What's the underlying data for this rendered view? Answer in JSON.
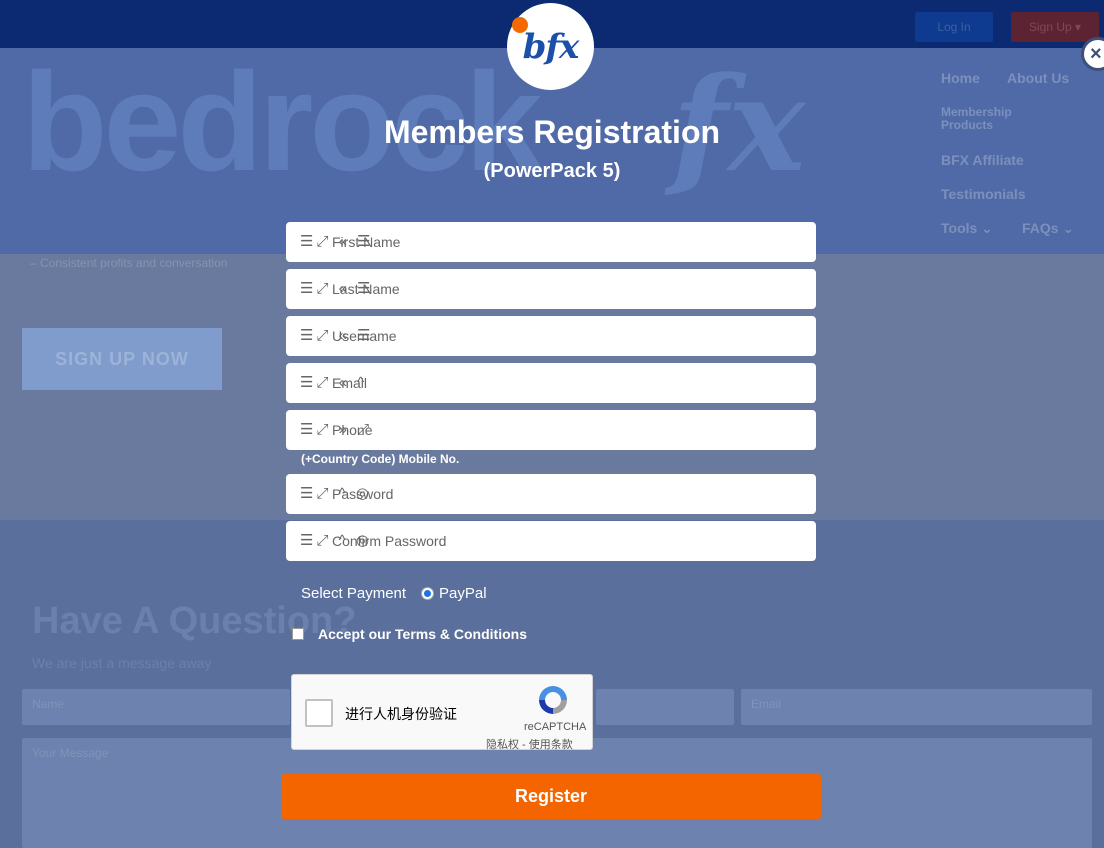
{
  "background": {
    "topbar": {
      "login_label": "Log In",
      "signup_label": "Sign Up ▾"
    },
    "logo_text": "bedrock",
    "logo_fx": "fx",
    "nav": [
      {
        "label": "Home"
      },
      {
        "label": "About Us"
      },
      {
        "label": "Membership Products"
      },
      {
        "label": "BFX Affiliate"
      },
      {
        "label": "Testimonials"
      },
      {
        "label": "Tools ⌄"
      },
      {
        "label": "FAQs ⌄"
      }
    ],
    "tagline": "– Consistent profits and conversation",
    "signup_now": "SIGN UP NOW",
    "question_title": "Have A Question?",
    "question_subtitle": "We are just a message away",
    "name_placeholder": "Name",
    "email_placeholder": "Email",
    "message_placeholder": "Your Message"
  },
  "modal": {
    "logo": "bfx",
    "close_icon": "×",
    "title": "Members Registration",
    "subtitle": "(PowerPack 5)",
    "fields": [
      {
        "placeholder": "First Name",
        "icons": "☰⤢ « ☰"
      },
      {
        "placeholder": "Last Name",
        "icons": "☰⤢ « ☰"
      },
      {
        "placeholder": "Username",
        "icons": "☰⤢ « ☰"
      },
      {
        "placeholder": "Email",
        "icons": "☰⤢ « ^"
      },
      {
        "placeholder": "Phone",
        "icons": "☰⤢ » ⤢"
      },
      {
        "placeholder": "Password",
        "icons": "☰⤢ ^ ◎"
      },
      {
        "placeholder": "Confirm Password",
        "icons": "☰⤢ ^ ◎"
      }
    ],
    "phone_hint": "(+Country Code) Mobile No.",
    "payment": {
      "label": "Select Payment",
      "option": "PayPal"
    },
    "terms_label": "Accept our Terms & Conditions",
    "captcha": {
      "text": "进行人机身份验证",
      "brand": "reCAPTCHA",
      "links": "隐私权 - 使用条款"
    },
    "register_label": "Register"
  },
  "colors": {
    "accent": "#f46500",
    "brand_blue": "#1b4fa8",
    "overlay": "#5a6f9c"
  }
}
